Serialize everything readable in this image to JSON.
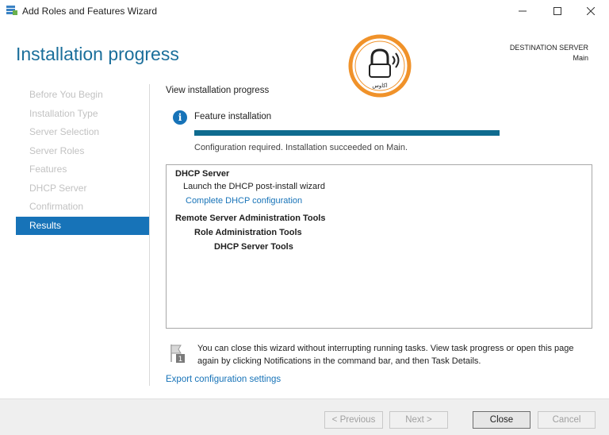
{
  "window": {
    "title": "Add Roles and Features Wizard"
  },
  "page": {
    "heading": "Installation progress"
  },
  "destination": {
    "label": "DESTINATION SERVER",
    "server": "Main"
  },
  "logo": {
    "text": "اکاوس"
  },
  "nav": {
    "items": [
      {
        "label": "Before You Begin"
      },
      {
        "label": "Installation Type"
      },
      {
        "label": "Server Selection"
      },
      {
        "label": "Server Roles"
      },
      {
        "label": "Features"
      },
      {
        "label": "DHCP Server"
      },
      {
        "label": "Confirmation"
      },
      {
        "label": "Results"
      }
    ],
    "active_index": 7
  },
  "main": {
    "section_label": "View installation progress",
    "feature_label": "Feature installation",
    "progress_fraction": 1.0,
    "status": "Configuration required. Installation succeeded on Main.",
    "results": [
      {
        "text": "DHCP Server",
        "level": 0,
        "bold": true
      },
      {
        "text": "Launch the DHCP post-install wizard",
        "level": 1
      },
      {
        "text": "Complete DHCP configuration",
        "level": 1,
        "link": true
      },
      {
        "text": "Remote Server Administration Tools",
        "level": 0,
        "bold": true
      },
      {
        "text": "Role Administration Tools",
        "level": 2,
        "bold": true
      },
      {
        "text": "DHCP Server Tools",
        "level": 3,
        "bold": true
      }
    ],
    "note": "You can close this wizard without interrupting running tasks. View task progress or open this page again by clicking Notifications in the command bar, and then Task Details.",
    "export_link": "Export configuration settings"
  },
  "footer": {
    "previous": "< Previous",
    "next": "Next >",
    "close": "Close",
    "cancel": "Cancel"
  },
  "colors": {
    "accent": "#1773b8",
    "heading": "#1b6f9b",
    "progress": "#0f6b8f",
    "logo_ring": "#f0922a"
  }
}
